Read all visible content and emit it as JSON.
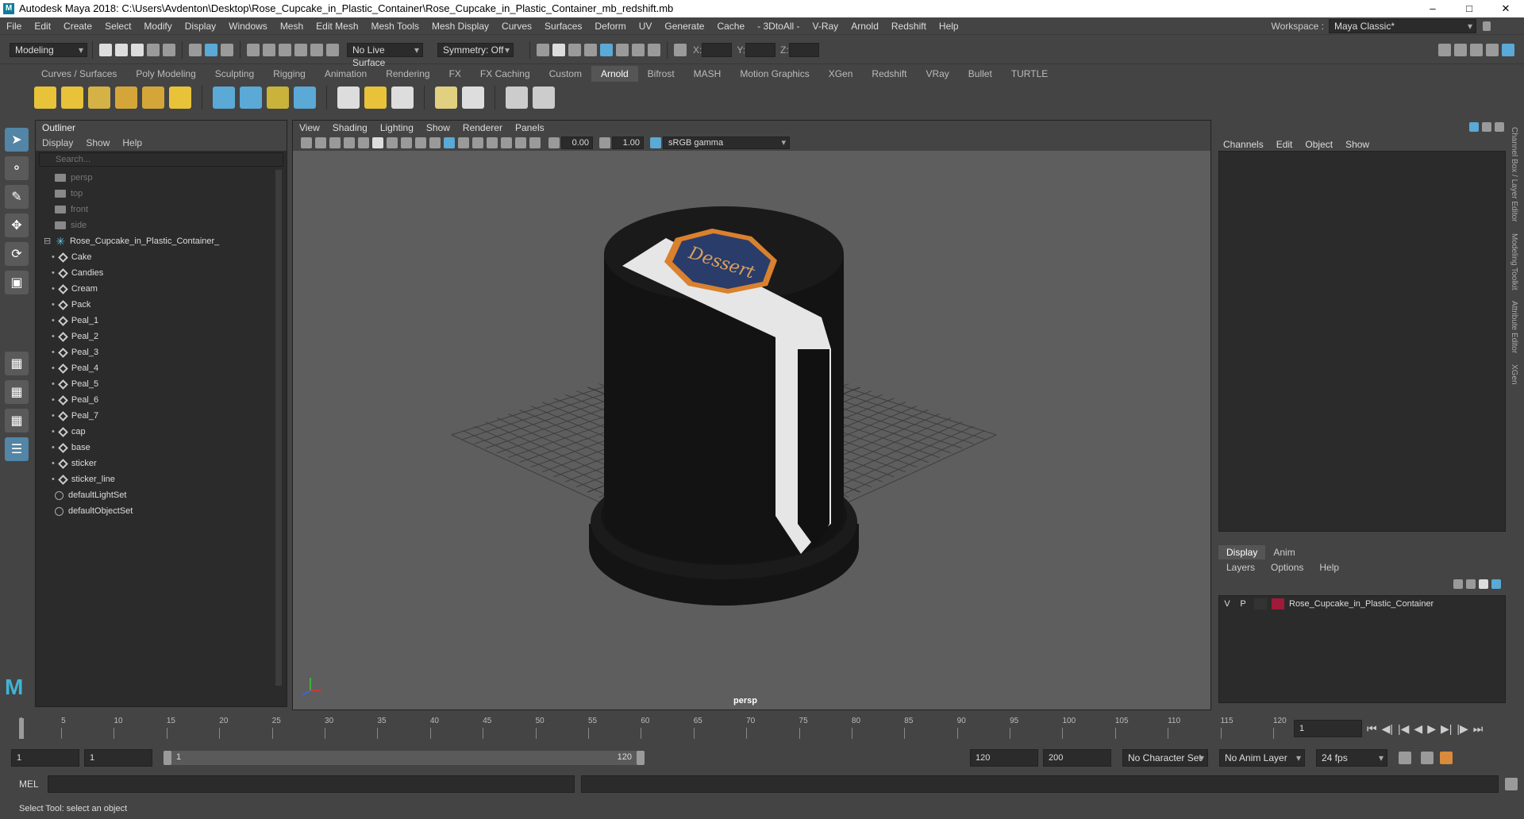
{
  "window": {
    "title": "Autodesk Maya 2018: C:\\Users\\Avdenton\\Desktop\\Rose_Cupcake_in_Plastic_Container\\Rose_Cupcake_in_Plastic_Container_mb_redshift.mb"
  },
  "menubar": {
    "items": [
      "File",
      "Edit",
      "Create",
      "Select",
      "Modify",
      "Display",
      "Windows",
      "Mesh",
      "Edit Mesh",
      "Mesh Tools",
      "Mesh Display",
      "Curves",
      "Surfaces",
      "Deform",
      "UV",
      "Generate",
      "Cache",
      "- 3DtoAll -",
      "V-Ray",
      "Arnold",
      "Redshift",
      "Help"
    ],
    "workspace_label": "Workspace :",
    "workspace_value": "Maya Classic*"
  },
  "statusline": {
    "mode": "Modeling",
    "live_surface": "No Live Surface",
    "symmetry": "Symmetry: Off",
    "x_label": "X:",
    "y_label": "Y:",
    "z_label": "Z:"
  },
  "shelf": {
    "tabs": [
      "Curves / Surfaces",
      "Poly Modeling",
      "Sculpting",
      "Rigging",
      "Animation",
      "Rendering",
      "FX",
      "FX Caching",
      "Custom",
      "Arnold",
      "Bifrost",
      "MASH",
      "Motion Graphics",
      "XGen",
      "Redshift",
      "VRay",
      "Bullet",
      "TURTLE"
    ],
    "active": "Arnold"
  },
  "outliner": {
    "title": "Outliner",
    "menu": [
      "Display",
      "Show",
      "Help"
    ],
    "search_placeholder": "Search...",
    "nodes": [
      {
        "label": "persp",
        "type": "camera"
      },
      {
        "label": "top",
        "type": "camera"
      },
      {
        "label": "front",
        "type": "camera"
      },
      {
        "label": "side",
        "type": "camera"
      },
      {
        "label": "Rose_Cupcake_in_Plastic_Container_",
        "type": "group"
      },
      {
        "label": "Cake",
        "type": "mesh"
      },
      {
        "label": "Candies",
        "type": "mesh"
      },
      {
        "label": "Cream",
        "type": "mesh"
      },
      {
        "label": "Pack",
        "type": "mesh"
      },
      {
        "label": "Peal_1",
        "type": "mesh"
      },
      {
        "label": "Peal_2",
        "type": "mesh"
      },
      {
        "label": "Peal_3",
        "type": "mesh"
      },
      {
        "label": "Peal_4",
        "type": "mesh"
      },
      {
        "label": "Peal_5",
        "type": "mesh"
      },
      {
        "label": "Peal_6",
        "type": "mesh"
      },
      {
        "label": "Peal_7",
        "type": "mesh"
      },
      {
        "label": "cap",
        "type": "mesh"
      },
      {
        "label": "base",
        "type": "mesh"
      },
      {
        "label": "sticker",
        "type": "mesh"
      },
      {
        "label": "sticker_line",
        "type": "mesh"
      },
      {
        "label": "defaultLightSet",
        "type": "set"
      },
      {
        "label": "defaultObjectSet",
        "type": "set"
      }
    ]
  },
  "viewport": {
    "menu": [
      "View",
      "Shading",
      "Lighting",
      "Show",
      "Renderer",
      "Panels"
    ],
    "exposure": "0.00",
    "gamma": "1.00",
    "colorspace": "sRGB gamma",
    "camera": "persp",
    "sticker_text": "Dessert"
  },
  "channelbox": {
    "menu": [
      "Channels",
      "Edit",
      "Object",
      "Show"
    ],
    "tabs": [
      "Display",
      "Anim"
    ],
    "layer_menu": [
      "Layers",
      "Options",
      "Help"
    ],
    "layers": [
      {
        "v": "V",
        "p": "P",
        "name": "Rose_Cupcake_in_Plastic_Container",
        "color": "#a01a3a"
      }
    ],
    "side_tabs": [
      "Channel Box / Layer Editor",
      "Modeling Toolkit",
      "Attribute Editor",
      "XGen"
    ]
  },
  "timeline": {
    "ticks": [
      "1",
      "5",
      "10",
      "15",
      "20",
      "25",
      "30",
      "35",
      "40",
      "45",
      "50",
      "55",
      "60",
      "65",
      "70",
      "75",
      "80",
      "85",
      "90",
      "95",
      "100",
      "105",
      "110",
      "115",
      "120"
    ],
    "current_frame": "1"
  },
  "range": {
    "start": "1",
    "playback_start": "1",
    "slider_start": "1",
    "slider_end": "120",
    "end": "120",
    "anim_end": "200",
    "character_set": "No Character Set",
    "anim_layer": "No Anim Layer",
    "fps": "24 fps"
  },
  "cmdline": {
    "label": "MEL"
  },
  "helpline": {
    "text": "Select Tool: select an object"
  }
}
